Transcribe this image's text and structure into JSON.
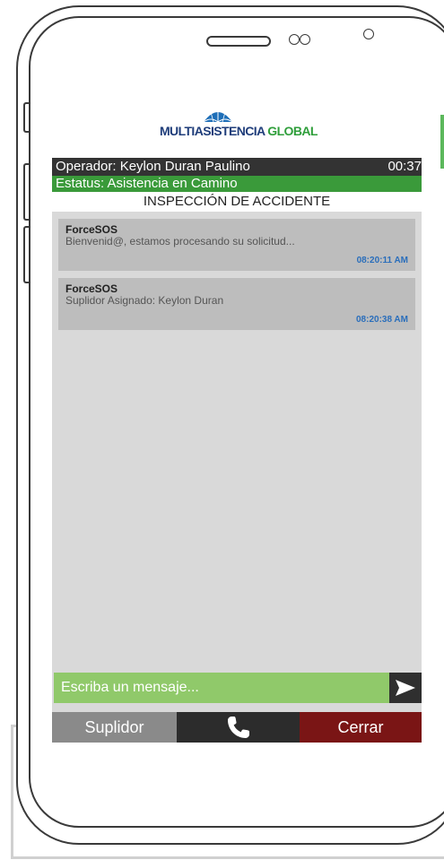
{
  "brand": {
    "logo_part1": "MULTIASISTENCIA",
    "logo_part2": "GLOBAL",
    "primary_color": "#1f3d7a",
    "accent_color": "#2e9e3a"
  },
  "header": {
    "operator_label": "Operador: Keylon Duran Paulino",
    "timer": "00:37",
    "status_label": "Estatus: Asistencia en Camino",
    "title": "INSPECCIÓN DE ACCIDENTE"
  },
  "messages": [
    {
      "sender": "ForceSOS",
      "text": "Bienvenid@, estamos procesando su solicitud...",
      "time": "08:20:11 AM"
    },
    {
      "sender": "ForceSOS",
      "text": "Suplidor Asignado: Keylon Duran",
      "time": "08:20:38 AM"
    }
  ],
  "composer": {
    "placeholder": "Escriba un mensaje...",
    "send_icon": "send-arrow-icon"
  },
  "bottom_bar": {
    "suplidor_label": "Suplidor",
    "call_icon": "phone-icon",
    "cerrar_label": "Cerrar"
  },
  "colors": {
    "status_green": "#3a9a3a",
    "composer_green": "#90c96a",
    "close_red": "#7a1515",
    "time_blue": "#2a6ebb"
  }
}
